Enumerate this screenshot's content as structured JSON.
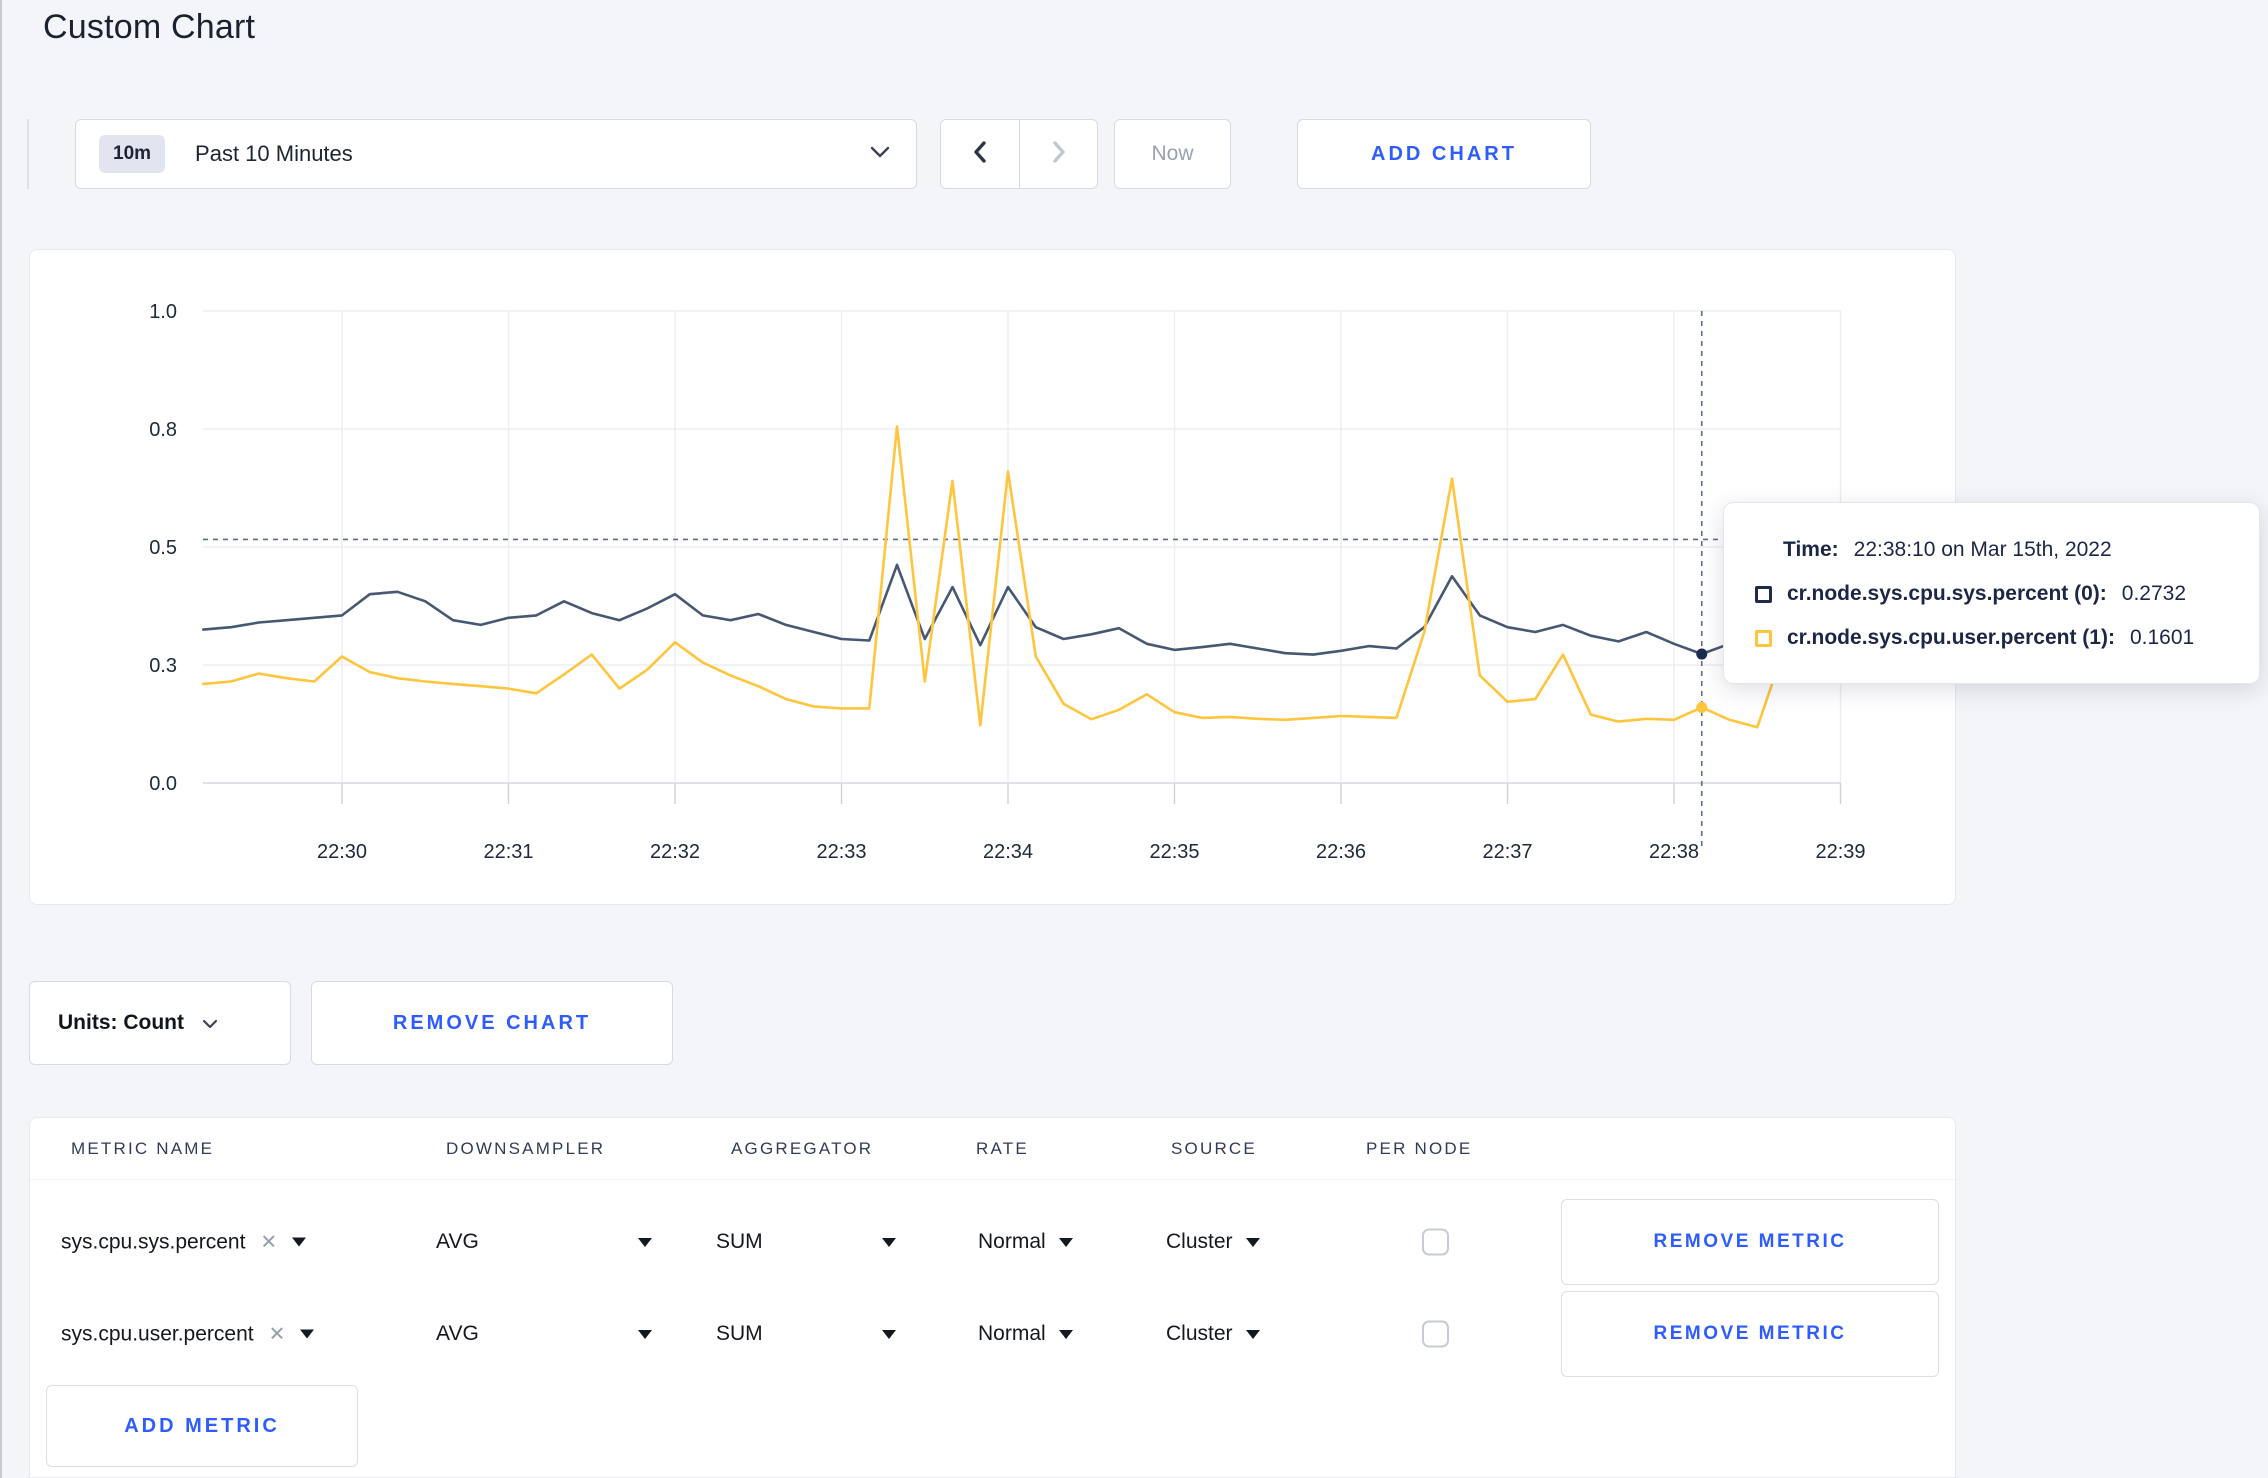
{
  "page": {
    "title": "Custom Chart"
  },
  "toolbar": {
    "time_window": {
      "badge": "10m",
      "label": "Past 10 Minutes"
    },
    "now_label": "Now",
    "add_chart_label": "ADD CHART"
  },
  "chart_controls": {
    "units_label": "Units: Count",
    "remove_chart_label": "REMOVE CHART"
  },
  "tooltip": {
    "time_label": "Time:",
    "time_value": "22:38:10 on Mar 15th, 2022",
    "series": [
      {
        "label": "cr.node.sys.cpu.sys.percent (0):",
        "value": "0.2732",
        "swatch_color": "#1e2b4d"
      },
      {
        "label": "cr.node.sys.cpu.user.percent (1):",
        "value": "0.1601",
        "swatch_color": "#ffc53d"
      }
    ]
  },
  "chart_data": {
    "type": "line",
    "title": "",
    "xlabel": "",
    "ylabel": "",
    "ylim": [
      0,
      1
    ],
    "grid": true,
    "x_start": "22:29:10",
    "x_interval_seconds": 10,
    "x_tick_labels": [
      "22:30",
      "22:31",
      "22:32",
      "22:33",
      "22:34",
      "22:35",
      "22:36",
      "22:37",
      "22:38",
      "22:39"
    ],
    "y_tick_labels": [
      "0.0",
      "0.3",
      "0.5",
      "0.8",
      "1.0"
    ],
    "y_tick_values": [
      0,
      0.25,
      0.5,
      0.75,
      1.0
    ],
    "series": [
      {
        "name": "cr.node.sys.cpu.sys.percent",
        "color": "#475872",
        "values": [
          0.325,
          0.33,
          0.34,
          0.345,
          0.35,
          0.355,
          0.4,
          0.405,
          0.385,
          0.345,
          0.335,
          0.35,
          0.355,
          0.385,
          0.36,
          0.345,
          0.37,
          0.4,
          0.355,
          0.345,
          0.358,
          0.335,
          0.32,
          0.305,
          0.302,
          0.462,
          0.305,
          0.415,
          0.292,
          0.415,
          0.33,
          0.305,
          0.315,
          0.328,
          0.295,
          0.282,
          0.288,
          0.295,
          0.285,
          0.275,
          0.272,
          0.28,
          0.29,
          0.285,
          0.33,
          0.438,
          0.355,
          0.33,
          0.32,
          0.335,
          0.312,
          0.3,
          0.32,
          0.295,
          0.2732,
          0.295,
          0.305,
          0.282,
          0.292,
          0.3
        ]
      },
      {
        "name": "cr.node.sys.cpu.user.percent",
        "color": "#ffc53d",
        "values": [
          0.21,
          0.215,
          0.232,
          0.222,
          0.215,
          0.268,
          0.235,
          0.222,
          0.215,
          0.21,
          0.205,
          0.2,
          0.19,
          0.23,
          0.272,
          0.2,
          0.24,
          0.298,
          0.255,
          0.228,
          0.205,
          0.178,
          0.162,
          0.158,
          0.158,
          0.755,
          0.215,
          0.64,
          0.122,
          0.66,
          0.268,
          0.168,
          0.135,
          0.155,
          0.188,
          0.15,
          0.138,
          0.14,
          0.136,
          0.134,
          0.138,
          0.142,
          0.14,
          0.138,
          0.32,
          0.645,
          0.228,
          0.172,
          0.178,
          0.272,
          0.145,
          0.13,
          0.136,
          0.134,
          0.1601,
          0.134,
          0.118,
          0.29,
          0.297,
          0.235
        ]
      }
    ],
    "hover": {
      "time": "22:38:10",
      "index": 54,
      "crosshair_y_value": 0.516,
      "values": [
        0.2732,
        0.1601
      ],
      "dot_colors": [
        "#1e2b4d",
        "#ffc53d"
      ]
    },
    "legend_position": "none"
  },
  "metrics_table": {
    "columns": [
      "METRIC NAME",
      "DOWNSAMPLER",
      "AGGREGATOR",
      "RATE",
      "SOURCE",
      "PER NODE"
    ],
    "rows": [
      {
        "metric": "sys.cpu.sys.percent",
        "downsampler": "AVG",
        "aggregator": "SUM",
        "rate": "Normal",
        "source": "Cluster",
        "per_node_checked": false,
        "remove_label": "REMOVE METRIC"
      },
      {
        "metric": "sys.cpu.user.percent",
        "downsampler": "AVG",
        "aggregator": "SUM",
        "rate": "Normal",
        "source": "Cluster",
        "per_node_checked": false,
        "remove_label": "REMOVE METRIC"
      }
    ],
    "add_metric_label": "ADD METRIC"
  },
  "colors": {
    "accent_blue": "#2e5cff",
    "series_sys": "#475872",
    "series_user": "#ffc53d",
    "grid": "#ededf2"
  }
}
